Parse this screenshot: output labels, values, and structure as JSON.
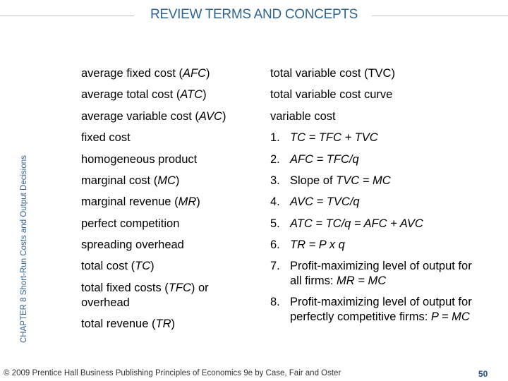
{
  "title": "REVIEW TERMS AND CONCEPTS",
  "side_label": "CHAPTER 8  Short-Run Costs and Output Decisions",
  "left_terms": [
    [
      {
        "t": "average fixed cost ("
      },
      {
        "t": "AFC",
        "i": true
      },
      {
        "t": ")"
      }
    ],
    [
      {
        "t": "average total cost ("
      },
      {
        "t": "ATC",
        "i": true
      },
      {
        "t": ")"
      }
    ],
    [
      {
        "t": "average variable cost ("
      },
      {
        "t": "AVC",
        "i": true
      },
      {
        "t": ")"
      }
    ],
    [
      {
        "t": "fixed cost"
      }
    ],
    [
      {
        "t": "homogeneous product"
      }
    ],
    [
      {
        "t": "marginal cost ("
      },
      {
        "t": "MC",
        "i": true
      },
      {
        "t": ")"
      }
    ],
    [
      {
        "t": "marginal revenue ("
      },
      {
        "t": "MR",
        "i": true
      },
      {
        "t": ")"
      }
    ],
    [
      {
        "t": "perfect competition"
      }
    ],
    [
      {
        "t": "spreading overhead"
      }
    ],
    [
      {
        "t": "total cost ("
      },
      {
        "t": "TC",
        "i": true
      },
      {
        "t": ")"
      }
    ],
    [
      {
        "t": "total fixed costs ("
      },
      {
        "t": "TFC",
        "i": true
      },
      {
        "t": ") or"
      },
      {
        "br": true
      },
      {
        "t": "overhead"
      }
    ],
    [
      {
        "t": "total revenue ("
      },
      {
        "t": "TR",
        "i": true
      },
      {
        "t": ")"
      }
    ]
  ],
  "right_terms": [
    [
      {
        "t": "total variable cost (TVC)"
      }
    ],
    [
      {
        "t": "total variable cost curve"
      }
    ],
    [
      {
        "t": "variable cost"
      }
    ]
  ],
  "equations": [
    {
      "n": "1.",
      "parts": [
        {
          "t": "TC = TFC + TVC",
          "i": true
        }
      ]
    },
    {
      "n": "2.",
      "parts": [
        {
          "t": "AFC = TFC/q",
          "i": true
        }
      ]
    },
    {
      "n": "3.",
      "parts": [
        {
          "t": "Slope of "
        },
        {
          "t": "TVC = MC",
          "i": true
        }
      ]
    },
    {
      "n": "4.",
      "parts": [
        {
          "t": "AVC = TVC/q",
          "i": true
        }
      ]
    },
    {
      "n": "5.",
      "parts": [
        {
          "t": "ATC = TC/q = AFC + AVC",
          "i": true
        }
      ]
    },
    {
      "n": "6.",
      "parts": [
        {
          "t": "TR = P x q",
          "i": true
        }
      ]
    },
    {
      "n": "7.",
      "parts": [
        {
          "t": "Profit-maximizing level of output for"
        },
        {
          "br": true
        },
        {
          "t": "all firms:  "
        },
        {
          "t": "MR = MC",
          "i": true
        }
      ]
    },
    {
      "n": "8.",
      "parts": [
        {
          "t": "Profit-maximizing level of output for"
        },
        {
          "br": true
        },
        {
          "t": "perfectly competitive firms:  "
        },
        {
          "t": "P = MC",
          "i": true
        }
      ]
    }
  ],
  "footer": "© 2009 Prentice Hall Business Publishing   Principles of Economics 9e by Case, Fair and Oster",
  "page_number": "50",
  "colors": {
    "accent": "#2e6491"
  }
}
